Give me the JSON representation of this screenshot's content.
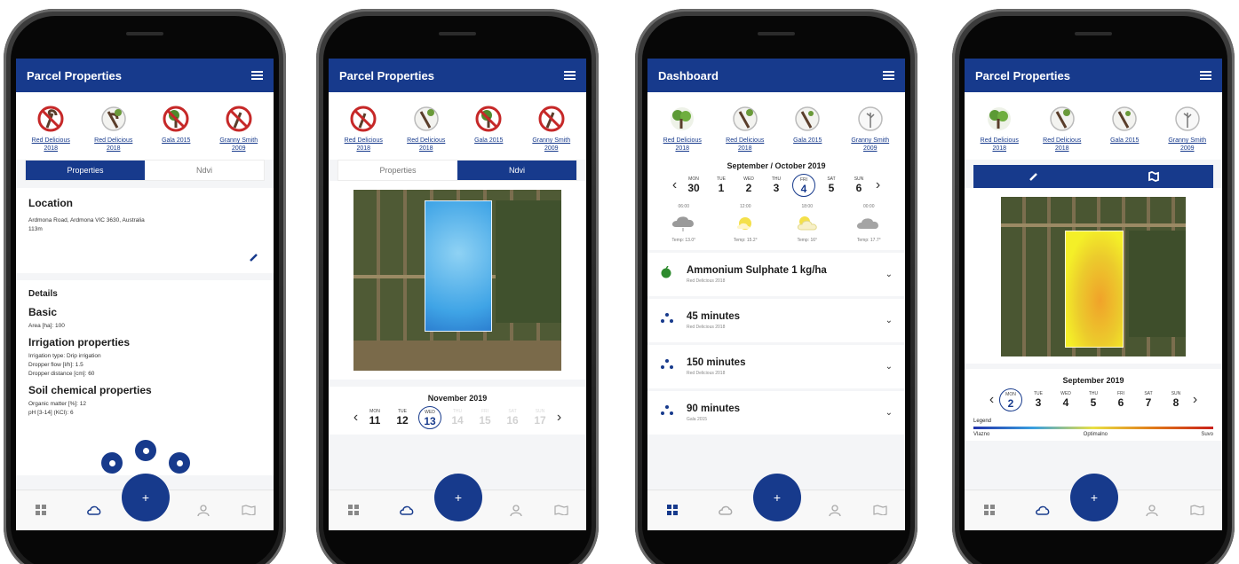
{
  "phones": [
    {
      "title": "Parcel Properties",
      "trees": [
        {
          "label_1": "Red Delicious",
          "label_2": "2018",
          "icon": "forbidden-tree-icon"
        },
        {
          "label_1": "Red Delicious",
          "label_2": "2018",
          "icon": "tree-icon"
        },
        {
          "label_1": "Gala 2015",
          "label_2": "",
          "icon": "forbidden-tree-icon"
        },
        {
          "label_1": "Granny Smith",
          "label_2": "2009",
          "icon": "forbidden-tree-icon"
        }
      ],
      "tabs": {
        "properties": "Properties",
        "ndvi": "Ndvi"
      },
      "location": {
        "heading": "Location",
        "address": "Ardmona Road, Ardmona VIC 3630, Australia",
        "altitude": "113m"
      },
      "details": {
        "heading": "Details",
        "basic_heading": "Basic",
        "area": "Area [ha]: 100",
        "irrigation_heading": "Irrigation properties",
        "irrigation_type": "Irrigation type: Drip irrigation",
        "dropper_flow": "Dropper flow [l/h]: 1.5",
        "dropper_distance": "Dropper distance [cm]: 60",
        "soil_heading": "Soil chemical properties",
        "organic_matter": "Organic matter [%]: 12",
        "ph": "pH [3-14] (KCl): 6"
      },
      "fab": "+"
    },
    {
      "title": "Parcel Properties",
      "trees": [
        {
          "label_1": "Red Delicious",
          "label_2": "2018"
        },
        {
          "label_1": "Red Delicious",
          "label_2": "2018"
        },
        {
          "label_1": "Gala 2015",
          "label_2": ""
        },
        {
          "label_1": "Granny Smith",
          "label_2": "2009"
        }
      ],
      "tabs": {
        "properties": "Properties",
        "ndvi": "Ndvi"
      },
      "calendar": {
        "month": "November 2019",
        "days": [
          {
            "name": "MON",
            "num": "11"
          },
          {
            "name": "TUE",
            "num": "12"
          },
          {
            "name": "WED",
            "num": "13"
          },
          {
            "name": "THU",
            "num": "14"
          },
          {
            "name": "FRI",
            "num": "15"
          },
          {
            "name": "SAT",
            "num": "16"
          },
          {
            "name": "SUN",
            "num": "17"
          }
        ],
        "selected_index": 2
      },
      "fab": "+"
    },
    {
      "title": "Dashboard",
      "trees": [
        {
          "label_1": "Red Delicious",
          "label_2": "2018"
        },
        {
          "label_1": "Red Delicious",
          "label_2": "2018"
        },
        {
          "label_1": "Gala 2015",
          "label_2": ""
        },
        {
          "label_1": "Granny Smith",
          "label_2": "2009"
        }
      ],
      "calendar": {
        "month": "September / October 2019",
        "days": [
          {
            "name": "MON",
            "num": "30"
          },
          {
            "name": "TUE",
            "num": "1"
          },
          {
            "name": "WED",
            "num": "2"
          },
          {
            "name": "THU",
            "num": "3"
          },
          {
            "name": "FRI",
            "num": "4"
          },
          {
            "name": "SAT",
            "num": "5"
          },
          {
            "name": "SUN",
            "num": "6"
          }
        ],
        "selected_index": 4
      },
      "weather": [
        {
          "time": "06:00",
          "temp": "Temp: 13.0°",
          "icon": "rain-cloud-icon"
        },
        {
          "time": "12:00",
          "temp": "Temp: 15.2°",
          "icon": "sun-icon"
        },
        {
          "time": "18:00",
          "temp": "Temp: 16°",
          "icon": "partly-cloudy-icon"
        },
        {
          "time": "00:00",
          "temp": "Temp: 17.7°",
          "icon": "cloud-icon"
        }
      ],
      "tasks": [
        {
          "name": "Ammonium Sulphate 1 kg/ha",
          "sub": "Red Delicious 2018",
          "icon": "fertilizer-icon"
        },
        {
          "name": "45 minutes",
          "sub": "Red Delicious 2018",
          "icon": "irrigation-drops-icon"
        },
        {
          "name": "150 minutes",
          "sub": "Red Delicious 2018",
          "icon": "irrigation-drops-icon"
        },
        {
          "name": "90 minutes",
          "sub": "Gala 2015",
          "icon": "irrigation-drops-icon"
        }
      ],
      "fab": "+"
    },
    {
      "title": "Parcel Properties",
      "trees": [
        {
          "label_1": "Red Delicious",
          "label_2": "2018"
        },
        {
          "label_1": "Red Delicious",
          "label_2": "2018"
        },
        {
          "label_1": "Gala 2015",
          "label_2": ""
        },
        {
          "label_1": "Granny Smith",
          "label_2": "2009"
        }
      ],
      "calendar": {
        "month": "September 2019",
        "days": [
          {
            "name": "MON",
            "num": "2"
          },
          {
            "name": "TUE",
            "num": "3"
          },
          {
            "name": "WED",
            "num": "4"
          },
          {
            "name": "THU",
            "num": "5"
          },
          {
            "name": "FRI",
            "num": "6"
          },
          {
            "name": "SAT",
            "num": "7"
          },
          {
            "name": "SUN",
            "num": "8"
          }
        ],
        "selected_index": 0
      },
      "legend": {
        "title": "Legend",
        "low": "Vlazno",
        "mid": "Optimalno",
        "high": "Suvo"
      },
      "fab": "+"
    }
  ],
  "colors": {
    "primary": "#173a8c",
    "background": "#f4f5f7"
  }
}
